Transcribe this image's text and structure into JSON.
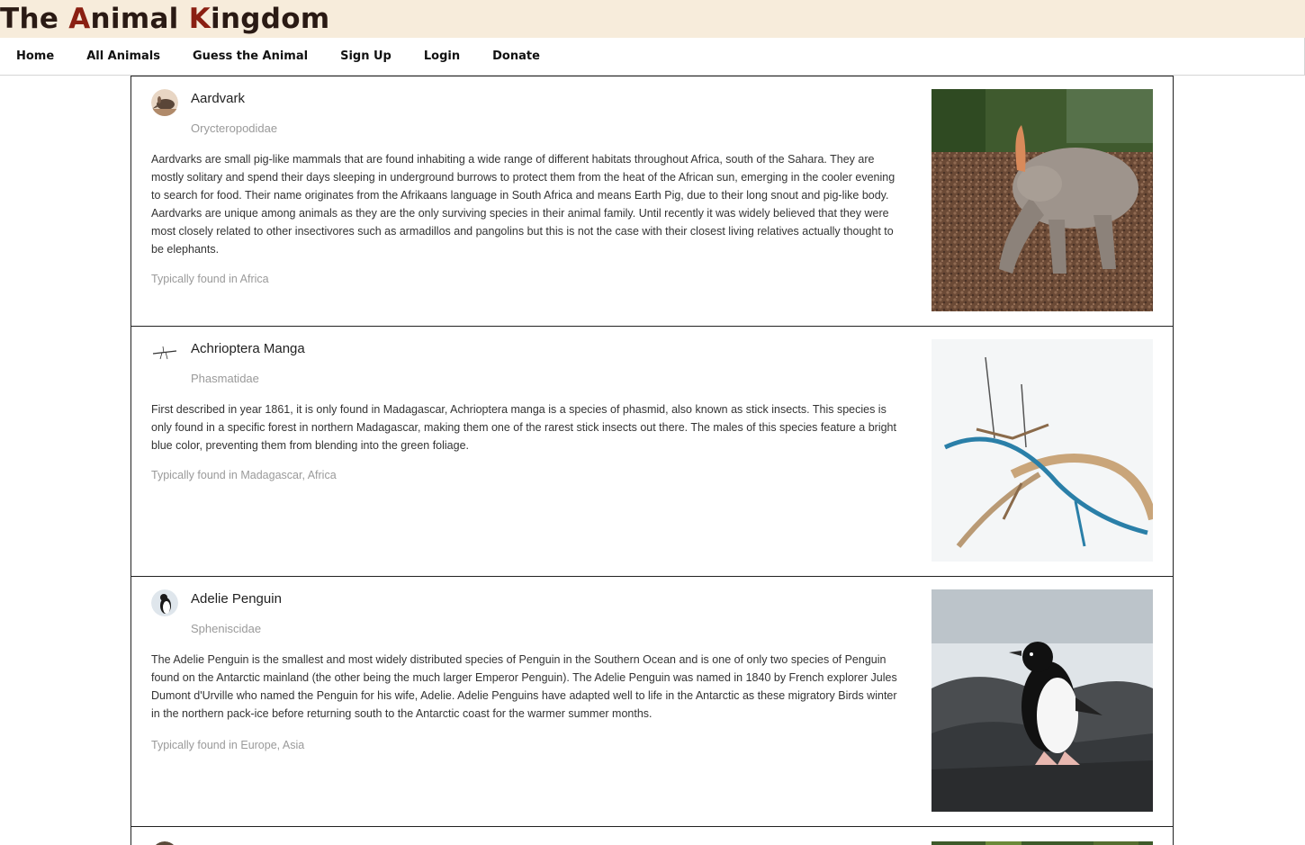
{
  "site": {
    "title_parts": [
      "T",
      "he ",
      "A",
      "nimal ",
      "K",
      "ingdom"
    ]
  },
  "nav": {
    "items": [
      {
        "label": "Home"
      },
      {
        "label": "All Animals"
      },
      {
        "label": "Guess the Animal"
      },
      {
        "label": "Sign Up"
      },
      {
        "label": "Login"
      },
      {
        "label": "Donate"
      }
    ]
  },
  "animals": [
    {
      "name": "Aardvark",
      "family": "Orycteropodidae",
      "description": "Aardvarks are small pig-like mammals that are found inhabiting a wide range of different habitats throughout Africa, south of the Sahara. They are mostly solitary and spend their days sleeping in underground burrows to protect them from the heat of the African sun, emerging in the cooler evening to search for food. Their name originates from the Afrikaans language in South Africa and means Earth Pig, due to their long snout and pig-like body. Aardvarks are unique among animals as they are the only surviving species in their animal family. Until recently it was widely believed that they were most closely related to other insectivores such as armadillos and pangolins but this is not the case with their closest living relatives actually thought to be elephants.",
      "region": "Typically found in Africa",
      "avatar_icon": "aardvark-icon",
      "photo_icon": "aardvark-photo"
    },
    {
      "name": "Achrioptera Manga",
      "family": "Phasmatidae",
      "description": "First described in year 1861, it is only found in Madagascar, Achrioptera manga is a species of phasmid, also known as stick insects. This species is only found in a specific forest in northern Madagascar, making them one of the rarest stick insects out there. The males of this species feature a bright blue color, preventing them from blending into the green foliage.",
      "region": "Typically found in Madagascar, Africa",
      "avatar_icon": "stick-insect-icon",
      "photo_icon": "stick-insect-photo"
    },
    {
      "name": "Adelie Penguin",
      "family": "Spheniscidae",
      "description": "The Adelie Penguin is the smallest and most widely distributed species of Penguin in the Southern Ocean and is one of only two species of Penguin found on the Antarctic mainland (the other being the much larger Emperor Penguin). The Adelie Penguin was named in 1840 by French explorer Jules Dumont d'Urville who named the Penguin for his wife, Adelie. Adelie Penguins have adapted well to life in the Antarctic as these migratory Birds winter in the northern pack-ice before returning south to the Antarctic coast for the warmer summer months.",
      "region": "Typically found in Europe, Asia",
      "avatar_icon": "penguin-icon",
      "photo_icon": "penguin-photo"
    }
  ],
  "colors": {
    "header_bg": "#f7ecdb",
    "title_dark": "#2a1a14",
    "title_accent": "#8a1f12",
    "card_border": "#222222",
    "muted_text": "#9a9a9a"
  }
}
